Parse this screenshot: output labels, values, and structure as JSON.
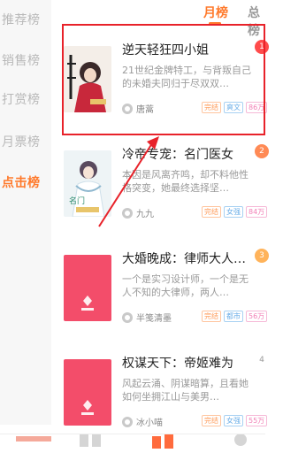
{
  "sidebar": {
    "items": [
      {
        "label": "推荐榜",
        "active": false
      },
      {
        "label": "销售榜",
        "active": false
      },
      {
        "label": "打赏榜",
        "active": false
      },
      {
        "label": "月票榜",
        "active": false
      },
      {
        "label": "点击榜",
        "active": true
      }
    ]
  },
  "tabs": [
    {
      "label": "月榜",
      "active": true
    },
    {
      "label": "总榜",
      "active": false
    }
  ],
  "books": [
    {
      "title": "逆天轻狂四小姐",
      "desc": "21世纪金牌特工，与背叛自己的未婚夫同归于尽双双…",
      "author": "唐蒿",
      "tags": [
        {
          "text": "完结",
          "color": "orange"
        },
        {
          "text": "爽文",
          "color": "blue"
        },
        {
          "text": "86万",
          "color": "pink"
        }
      ],
      "rank": "1",
      "rank_color": "#ff4b4b",
      "cover": "cover-girl-red"
    },
    {
      "title": "冷帝专宠：名门医女",
      "desc": "本因是风离齐鸣，却不料他性格突变，她最终选择坚…",
      "author": "九九",
      "tags": [
        {
          "text": "完结",
          "color": "orange"
        },
        {
          "text": "女强",
          "color": "blue"
        },
        {
          "text": "84万",
          "color": "pink"
        }
      ],
      "rank": "2",
      "rank_color": "#ff8a55",
      "cover": "cover-girl-white"
    },
    {
      "title": "大婚晚成：律师大人…",
      "desc": "一个是实习设计师，一个是无人不知的大律师，两人…",
      "author": "半笺清墨",
      "tags": [
        {
          "text": "完结",
          "color": "orange"
        },
        {
          "text": "都市",
          "color": "blue"
        },
        {
          "text": "56万",
          "color": "pink"
        }
      ],
      "rank": "3",
      "rank_color": "#ffb35a",
      "cover": "cover-pink-hmc"
    },
    {
      "title": "权谋天下：帝姬难为",
      "desc": "风起云涌、阴谋暗算，且看她如何坐拥江山与美男…",
      "author": "冰小喵",
      "tags": [
        {
          "text": "完结",
          "color": "orange"
        },
        {
          "text": "女强",
          "color": "blue"
        },
        {
          "text": "55万",
          "color": "pink"
        }
      ],
      "rank": "4",
      "rank_color": "#ffffff",
      "cover": "cover-pink-hmc"
    }
  ],
  "colors": {
    "accent": "#ff7a2c",
    "highlight": "#e8222a",
    "cover_pink": "#f34d6a"
  }
}
